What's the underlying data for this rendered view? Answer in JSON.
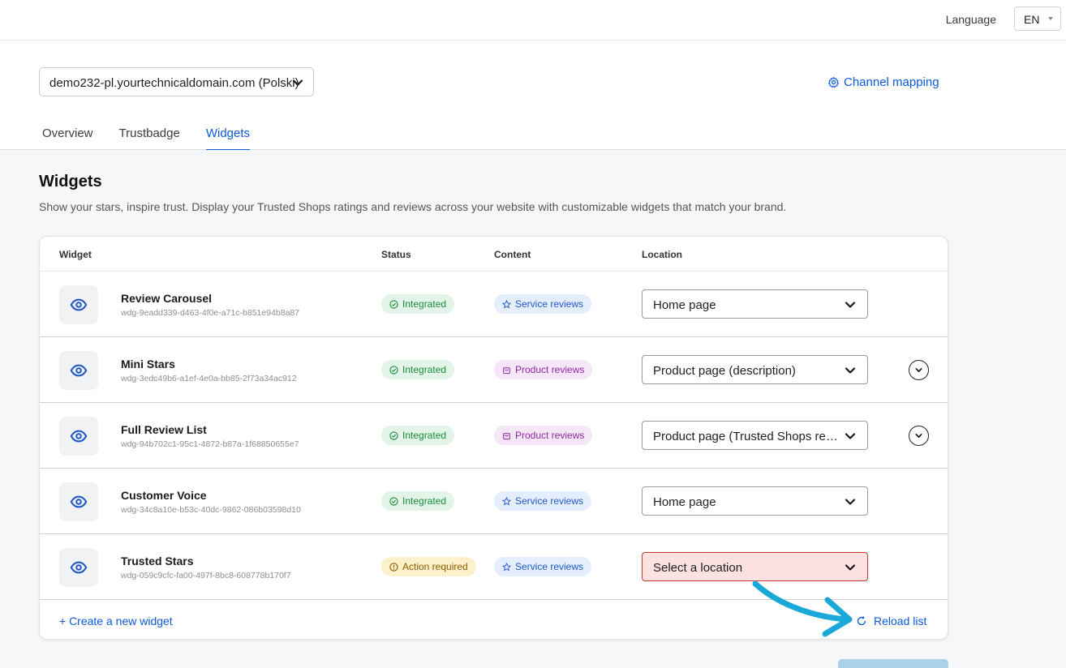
{
  "topbar": {
    "language_label": "Language",
    "language_value": "EN"
  },
  "channel": {
    "selected": "demo232-pl.yourtechnicaldomain.com (Polski)",
    "mapping_label": "Channel mapping"
  },
  "tabs": [
    {
      "label": "Overview",
      "active": false
    },
    {
      "label": "Trustbadge",
      "active": false
    },
    {
      "label": "Widgets",
      "active": true
    }
  ],
  "page": {
    "title": "Widgets",
    "description": "Show your stars, inspire trust. Display your Trusted Shops ratings and reviews across your website with customizable widgets that match your brand."
  },
  "table": {
    "headers": {
      "widget": "Widget",
      "status": "Status",
      "content": "Content",
      "location": "Location"
    },
    "rows": [
      {
        "name": "Review Carousel",
        "id": "wdg-9eadd339-d463-4f0e-a71c-b851e94b8a87",
        "status": "Integrated",
        "content": "Service reviews",
        "location": "Home page"
      },
      {
        "name": "Mini Stars",
        "id": "wdg-3edc49b6-a1ef-4e0a-bb85-2f73a34ac912",
        "status": "Integrated",
        "content": "Product reviews",
        "location": "Product page (description)"
      },
      {
        "name": "Full Review List",
        "id": "wdg-94b702c1-95c1-4872-b87a-1f68850655e7",
        "status": "Integrated",
        "content": "Product reviews",
        "location": "Product page (Trusted Shops reviews tab)"
      },
      {
        "name": "Customer Voice",
        "id": "wdg-34c8a10e-b53c-40dc-9862-086b03598d10",
        "status": "Integrated",
        "content": "Service reviews",
        "location": "Home page"
      },
      {
        "name": "Trusted Stars",
        "id": "wdg-059c9cfc-fa00-497f-8bc8-608778b170f7",
        "status": "Action required",
        "content": "Service reviews",
        "location": "Select a location"
      }
    ]
  },
  "footer": {
    "create_label": "+ Create a new widget",
    "reload_label": "Reload list"
  },
  "colors": {
    "accent": "#0b5ad8",
    "integrated_bg": "#e3f5e8",
    "action_required_bg": "#fdf1cc",
    "service_bg": "#e5eefc",
    "product_bg": "#f5e6f8",
    "error_bg": "#fde2e2",
    "annotation_arrow": "#1aa8d8"
  },
  "icons": {
    "preview": "eye-icon",
    "integrated": "check-circle-icon",
    "action_required": "alert-circle-icon",
    "service": "star-icon",
    "product": "bag-icon",
    "expand": "chevron-down-circle-icon",
    "reload": "refresh-icon",
    "mapping": "gear-icon"
  }
}
